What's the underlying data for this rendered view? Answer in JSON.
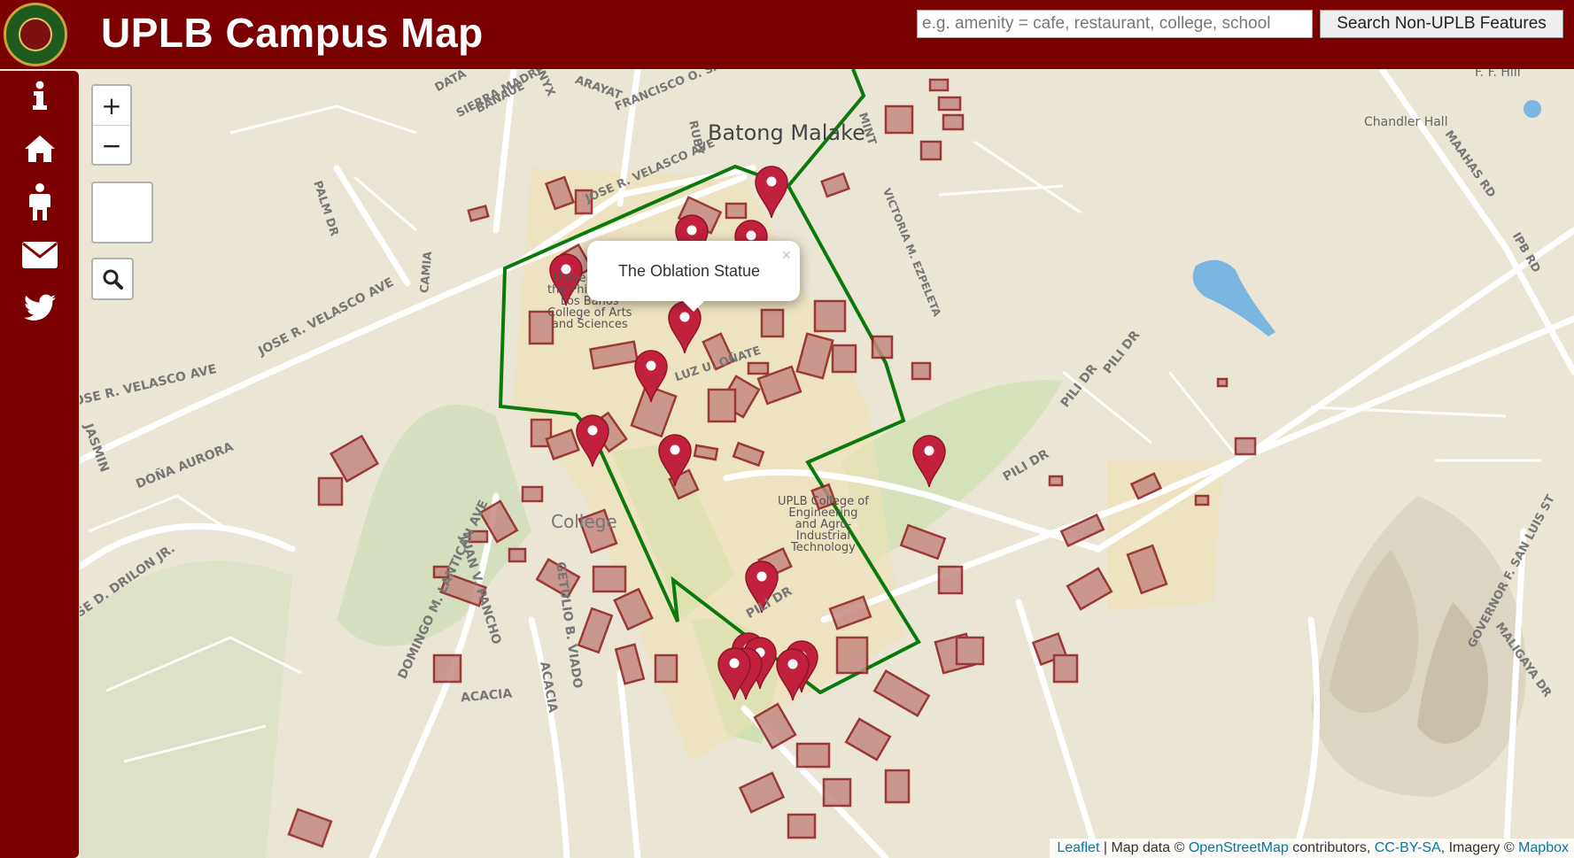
{
  "app": {
    "title": "UPLB Campus Map"
  },
  "search": {
    "placeholder": "e.g. amenity = cafe, restaurant, college, school",
    "button_label": "Search Non-UPLB Features"
  },
  "sidebar": {
    "items": [
      {
        "icon": "info-icon"
      },
      {
        "icon": "home-icon"
      },
      {
        "icon": "person-icon"
      },
      {
        "icon": "envelope-icon"
      },
      {
        "icon": "twitter-icon"
      }
    ]
  },
  "map_controls": {
    "zoom_in": "+",
    "zoom_out": "−"
  },
  "popup": {
    "text": "The Oblation Statue",
    "close": "×"
  },
  "map_labels": {
    "batong_malake": "Batong Malake",
    "college": "College",
    "cas_line1": "University of",
    "cas_line2": "the Philippines",
    "cas_line3": "Los Baños",
    "cas_line4": "College of Arts",
    "cas_line5": "and Sciences",
    "ceat_line1": "UPLB College of",
    "ceat_line2": "Engineering",
    "ceat_line3": "and Agro-",
    "ceat_line4": "Industrial",
    "ceat_line5": "Technology",
    "chandler": "Chandler Hall",
    "ff_hill": "F. F. Hill",
    "jose_velasco_1": "JOSE R. VELASCO AVE",
    "jose_velasco_2": "JOSE R. VELASCO AVE",
    "jose_velasco_3": "JOSE R. VELASCO AVE",
    "luz_onate": "LUZ U. OÑATE",
    "pili_dr_1": "PILI DR",
    "pili_dr_2": "PILI DR",
    "pili_dr_3": "PILI DR",
    "pili_dr_4": "PILI DR",
    "domingo": "DOMINGO M. LANTICAN AVE",
    "juan_pancho": "JUAN V. PANCHO",
    "getulio": "GETULIO B. VIADO",
    "acacia_1": "ACACIA",
    "acacia_2": "ACACIA",
    "dona_aurora": "DOÑA AURORA",
    "jasmin": "JASMIN",
    "drilon": "JOSE D. DRILON JR.",
    "maahas": "MAAHAS RD",
    "ipb": "IPB RD",
    "governor": "GOVERNOR F. SAN LUIS ST",
    "maligaya": "MALIGAYA DR",
    "mint": "MINT",
    "ruby": "RUBY",
    "palm": "PALM DR",
    "camia": "CAMIA",
    "data": "DATA",
    "sierra": "SIERRA MADRE",
    "banaue": "BANAUE",
    "onyx": "ONYX",
    "arayat": "ARAYAT",
    "francisco": "FRANCISCO O. SAN",
    "victoria": "VICTORIA M. EZPELETA"
  },
  "attribution": {
    "leaflet": "Leaflet",
    "sep1": " | Map data © ",
    "osm": "OpenStreetMap",
    "sep2": " contributors, ",
    "ccbysa": "CC-BY-SA",
    "sep3": ", Imagery © ",
    "mapbox": "Mapbox"
  },
  "colors": {
    "header": "#7b0000",
    "marker": "#c2213d",
    "boundary": "#0a7a0a",
    "building_fill": "#c48a82",
    "building_stroke": "#8c1a1a"
  }
}
